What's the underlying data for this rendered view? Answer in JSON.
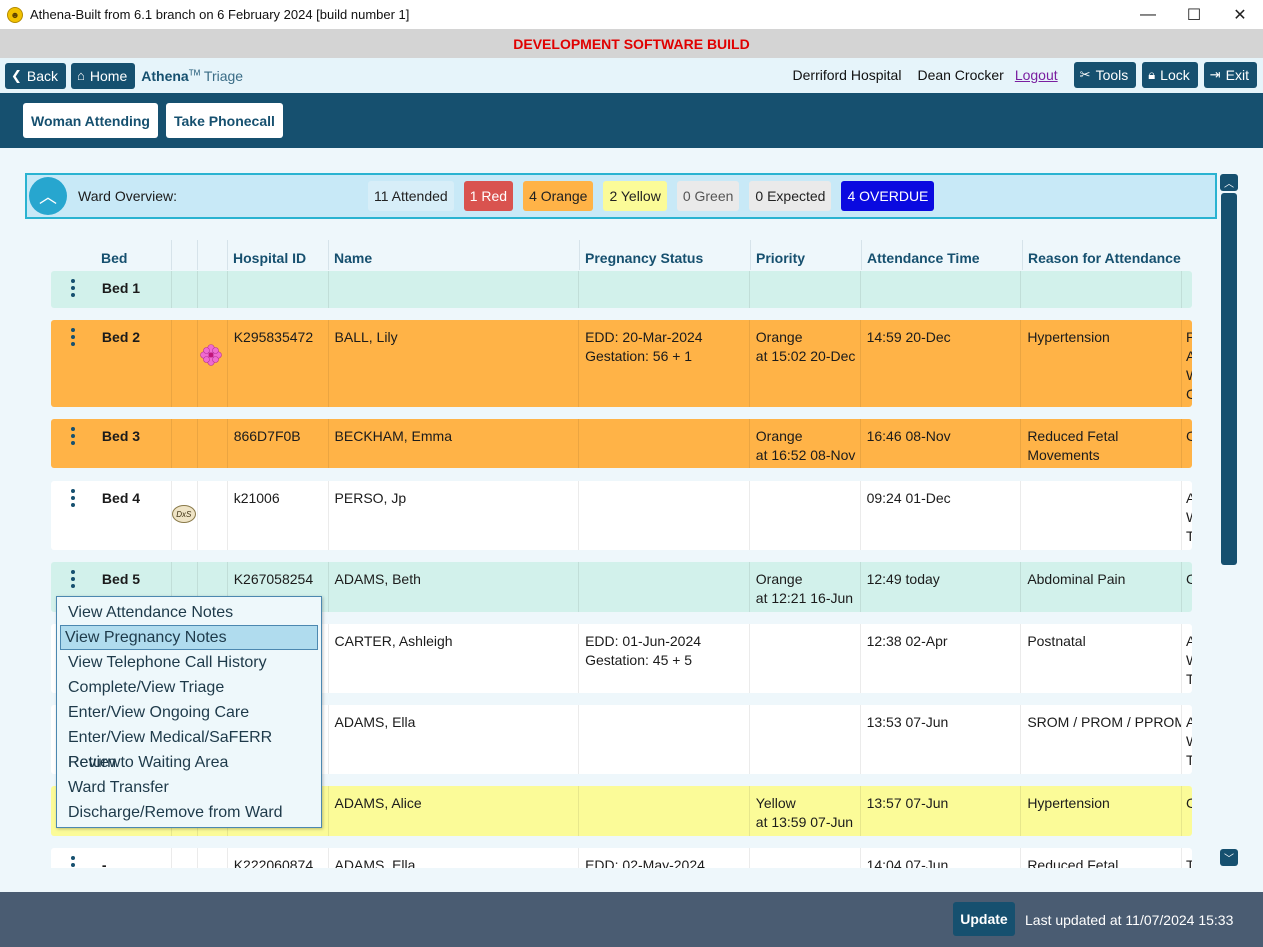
{
  "window": {
    "title": "Athena-Built from 6.1 branch on 6 February 2024 [build number 1]",
    "minimize": "—",
    "maximize": "☐",
    "close": "✕"
  },
  "banner": "DEVELOPMENT SOFTWARE BUILD",
  "nav": {
    "back": "Back",
    "home": "Home",
    "brand": "Athena",
    "brand_tm": "TM",
    "brand_sub": "Triage",
    "hospital": "Derriford Hospital",
    "user": "Dean Crocker",
    "logout": "Logout",
    "tools": "Tools",
    "lock": "Lock",
    "exit": "Exit"
  },
  "actions": {
    "woman_attending": "Woman Attending",
    "take_phonecall": "Take Phonecall"
  },
  "overview": {
    "label": "Ward Overview:",
    "attended": "11 Attended",
    "red": "1 Red",
    "orange": "4 Orange",
    "yellow": "2 Yellow",
    "green": "0 Green",
    "expected": "0 Expected",
    "overdue": "4 OVERDUE"
  },
  "colors": {
    "brand": "#16506f",
    "orange_row": "#ffb347",
    "teal_row": "#d2f1eb",
    "yellow_row": "#fbfb98",
    "red_pill": "#d9534f",
    "overdue_pill": "#0a0ae0"
  },
  "table": {
    "headers": {
      "bed": "Bed",
      "hospital_id": "Hospital ID",
      "name": "Name",
      "pregnancy_status": "Pregnancy Status",
      "priority": "Priority",
      "attendance_time": "Attendance Time",
      "reason": "Reason for Attendance"
    },
    "rows": [
      {
        "bed": "Bed 1",
        "icon": "",
        "hospital_id": "",
        "name": "",
        "preg1": "",
        "preg2": "",
        "pri1": "",
        "pri2": "",
        "time": "",
        "reason1": "",
        "reason2": "",
        "extra": [
          "",
          "",
          "",
          ""
        ]
      },
      {
        "bed": "Bed 2",
        "icon": "flower-icon",
        "hospital_id": "K295835472",
        "name": "BALL, Lily",
        "preg1": "EDD: 20-Mar-2024",
        "preg2": "Gestation: 56 + 1",
        "pri1": "Orange",
        "pri2": "at 15:02 20-Dec",
        "time": "14:59 20-Dec",
        "reason1": "Hypertension",
        "reason2": "",
        "extra": [
          "P",
          "A",
          "W",
          "C"
        ]
      },
      {
        "bed": "Bed 3",
        "icon": "",
        "hospital_id": "866D7F0B",
        "name": "BECKHAM, Emma",
        "preg1": "",
        "preg2": "",
        "pri1": "Orange",
        "pri2": "at 16:52 08-Nov",
        "time": "16:46 08-Nov",
        "reason1": "Reduced Fetal",
        "reason2": "Movements",
        "extra": [
          "C",
          "",
          "",
          ""
        ]
      },
      {
        "bed": "Bed 4",
        "icon": "dxs-icon",
        "hospital_id": "k21006",
        "name": "PERSO, Jp",
        "preg1": "",
        "preg2": "",
        "pri1": "",
        "pri2": "",
        "time": "09:24 01-Dec",
        "reason1": "",
        "reason2": "",
        "extra": [
          "A",
          "W",
          "T",
          ""
        ]
      },
      {
        "bed": "Bed 5",
        "icon": "",
        "hospital_id": "K267058254",
        "name": "ADAMS, Beth",
        "preg1": "",
        "preg2": "",
        "pri1": "Orange",
        "pri2": "at 12:21 16-Jun",
        "time": "12:49 today",
        "reason1": "Abdominal Pain",
        "reason2": "",
        "extra": [
          "C",
          "",
          "",
          ""
        ]
      },
      {
        "bed": "",
        "icon": "",
        "hospital_id": "",
        "name": "CARTER, Ashleigh",
        "preg1": "EDD: 01-Jun-2024",
        "preg2": "Gestation: 45 + 5",
        "pri1": "",
        "pri2": "",
        "time": "12:38 02-Apr",
        "reason1": "Postnatal",
        "reason2": "",
        "extra": [
          "A",
          "W",
          "T",
          ""
        ]
      },
      {
        "bed": "",
        "icon": "",
        "hospital_id": "",
        "name": "ADAMS, Ella",
        "preg1": "",
        "preg2": "",
        "pri1": "",
        "pri2": "",
        "time": "13:53 07-Jun",
        "reason1": "SROM / PROM / PPROM",
        "reason2": "",
        "extra": [
          "A",
          "W",
          "T",
          ""
        ]
      },
      {
        "bed": "",
        "icon": "",
        "hospital_id": "",
        "name": "ADAMS, Alice",
        "preg1": "",
        "preg2": "",
        "pri1": "Yellow",
        "pri2": "at 13:59 07-Jun",
        "time": "13:57 07-Jun",
        "reason1": "Hypertension",
        "reason2": "",
        "extra": [
          "C",
          "",
          "",
          ""
        ]
      },
      {
        "bed": "-",
        "icon": "flower-icon",
        "hospital_id": "K222060874",
        "name": "ADAMS, Ella",
        "preg1": "EDD: 02-May-2024",
        "preg2": "",
        "pri1": "",
        "pri2": "",
        "time": "14:04 07-Jun",
        "reason1": "Reduced Fetal",
        "reason2": "",
        "extra": [
          "T",
          "",
          "",
          ""
        ]
      }
    ]
  },
  "context_menu": [
    "View Attendance Notes",
    "View Pregnancy Notes",
    "View Telephone Call History",
    "Complete/View Triage",
    "Enter/View Ongoing Care",
    "Enter/View Medical/SaFERR Review",
    "Return to Waiting Area",
    "Ward Transfer",
    "Discharge/Remove from Ward"
  ],
  "context_menu_selected": 1,
  "footer": {
    "update": "Update",
    "last_updated": "Last updated at 11/07/2024 15:33"
  }
}
